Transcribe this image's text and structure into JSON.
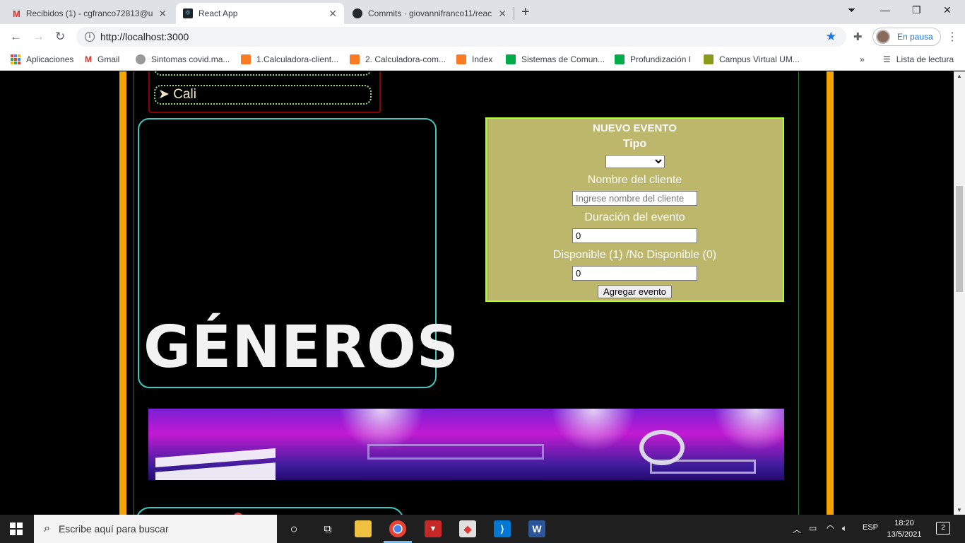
{
  "browser": {
    "tabs": [
      {
        "title": "Recibidos (1) - cgfranco72813@u",
        "favicon": "gmail-icon"
      },
      {
        "title": "React App",
        "favicon": "react-icon"
      },
      {
        "title": "Commits · giovannifranco11/reac",
        "favicon": "github-icon"
      }
    ],
    "url": "http://localhost:3000",
    "profile_label": "En pausa",
    "bookmarks": [
      {
        "label": "Aplicaciones"
      },
      {
        "label": "Gmail"
      },
      {
        "label": "Sintomas covid.ma..."
      },
      {
        "label": "1.Calculadora-client..."
      },
      {
        "label": "2. Calculadora-com..."
      },
      {
        "label": "Index"
      },
      {
        "label": "Sistemas de Comun..."
      },
      {
        "label": "Profundización I"
      },
      {
        "label": "Campus Virtual UM..."
      }
    ],
    "reading_list": "Lista de lectura"
  },
  "page": {
    "city": "➤ Cali",
    "generos_title": "GÉNEROS",
    "form": {
      "title": "NUEVO EVENTO",
      "tipo_label": "Tipo",
      "tipo_value": "",
      "cliente_label": "Nombre del cliente",
      "cliente_placeholder": "Ingrese nombre del cliente",
      "duracion_label": "Duración del evento",
      "duracion_value": "0",
      "disponible_label": "Disponible (1) /No Disponible (0)",
      "disponible_value": "0",
      "submit_label": "Agregar evento"
    },
    "colors": {
      "accent_orange": "#f5a300",
      "form_bg": "#bdb76b",
      "form_border": "#adff2f",
      "generos_border": "#3cc9c0"
    }
  },
  "taskbar": {
    "search_placeholder": "Escribe aquí para buscar",
    "language": "ESP",
    "time": "18:20",
    "date": "13/5/2021",
    "notification_count": "2"
  }
}
